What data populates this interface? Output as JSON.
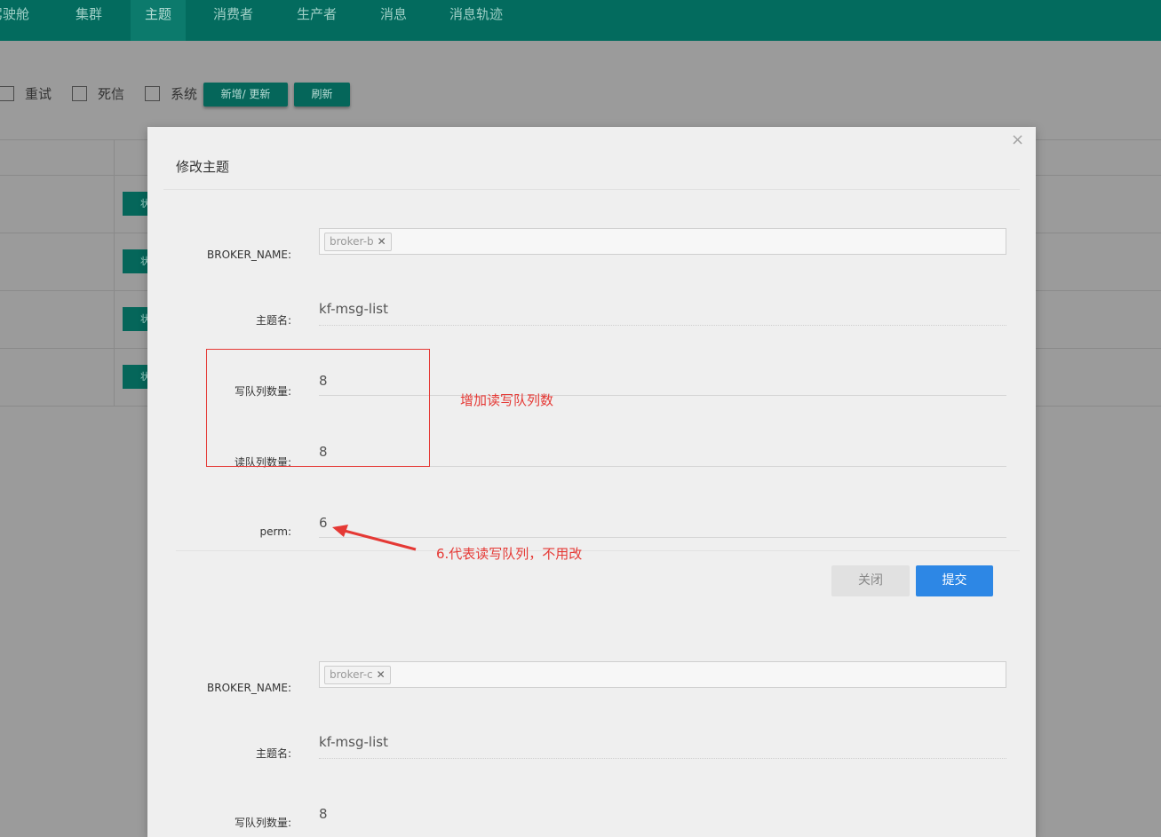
{
  "nav": {
    "items": [
      {
        "label": "驾驶舱",
        "active": false
      },
      {
        "label": "集群",
        "active": false
      },
      {
        "label": "主题",
        "active": true
      },
      {
        "label": "消费者",
        "active": false
      },
      {
        "label": "生产者",
        "active": false
      },
      {
        "label": "消息",
        "active": false
      },
      {
        "label": "消息轨迹",
        "active": false
      }
    ]
  },
  "toolbar": {
    "filters": [
      {
        "label": "重试",
        "checked": false
      },
      {
        "label": "死信",
        "checked": false
      },
      {
        "label": "系统",
        "checked": false
      }
    ],
    "add_update_label": "新增/ 更新",
    "refresh_label": "刷新"
  },
  "table": {
    "row_button_label": "状"
  },
  "modal": {
    "title": "修改主题",
    "close_symbol": "×",
    "sections": [
      {
        "broker_label": "BROKER_NAME:",
        "broker_tag": "broker-b",
        "topic_label": "主题名:",
        "topic_value": "kf-msg-list",
        "write_label": "写队列数量:",
        "write_value": "8",
        "read_label": "读队列数量:",
        "read_value": "8",
        "perm_label": "perm:",
        "perm_value": "6",
        "close_button": "关闭",
        "submit_button": "提交"
      },
      {
        "broker_label": "BROKER_NAME:",
        "broker_tag": "broker-c",
        "topic_label": "主题名:",
        "topic_value": "kf-msg-list",
        "write_label": "写队列数量:",
        "write_value": "8"
      }
    ]
  },
  "annotations": {
    "queue_note": "增加读写队列数",
    "perm_note": "6.代表读写队列，不用改",
    "color": "#e53935"
  },
  "colors": {
    "nav_bg": "#036b5e",
    "button_green": "#05665a",
    "submit_blue": "#2d87e5"
  }
}
